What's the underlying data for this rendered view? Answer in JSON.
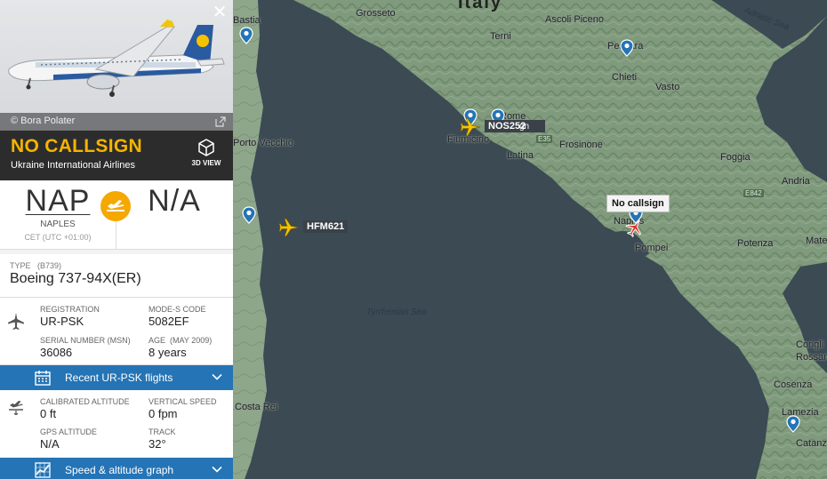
{
  "map": {
    "country_label": "Italy",
    "sea_labels": [
      "Tyrrhenian Sea",
      "Adriatic Sea"
    ],
    "cities": [
      "Grosseto",
      "Terni",
      "Ascoli Piceno",
      "Pescara",
      "Chieti",
      "Vasto",
      "Rome",
      "Fiumicino",
      "Frosinone",
      "Latina",
      "Foggia",
      "Andria",
      "Naples",
      "Pompei",
      "Potenza",
      "Matera",
      "Cosenza",
      "Lamezia",
      "Catanz",
      "Costa Rei",
      "Corigli",
      "Rossan",
      "Bastia",
      "Porto Vecchio"
    ],
    "road_labels": [
      "E35",
      "E842"
    ],
    "flights": [
      {
        "callsign": "HFM621"
      },
      {
        "callsign": "NOS252"
      }
    ],
    "selected_callout": "No callsign",
    "overlap_text": "gn"
  },
  "panel": {
    "photo_credit": "© Bora Polater",
    "callsign": "NO CALLSIGN",
    "airline": "Ukraine International Airlines",
    "view3d_label": "3D VIEW",
    "origin": {
      "code": "NAP",
      "city": "NAPLES",
      "tz": "CET (UTC +01:00)"
    },
    "destination": {
      "code": "N/A"
    },
    "type_label": "TYPE",
    "type_code": "(B739)",
    "type_value": "Boeing 737-94X(ER)",
    "registration": {
      "label": "REGISTRATION",
      "value": "UR-PSK"
    },
    "mode_s": {
      "label": "MODE-S CODE",
      "value": "5082EF"
    },
    "serial": {
      "label": "SERIAL NUMBER (MSN)",
      "value": "36086"
    },
    "age": {
      "label": "AGE",
      "sub": "(MAY 2009)",
      "value": "8 years"
    },
    "recent_flights_label": "Recent UR-PSK flights",
    "calibrated_altitude": {
      "label": "CALIBRATED ALTITUDE",
      "value": "0 ft"
    },
    "vertical_speed": {
      "label": "VERTICAL SPEED",
      "value": "0 fpm"
    },
    "gps_altitude": {
      "label": "GPS ALTITUDE",
      "value": "N/A"
    },
    "track": {
      "label": "TRACK",
      "value": "32°"
    },
    "graph_label": "Speed & altitude graph"
  },
  "colors": {
    "accent": "#f5b400",
    "bar": "#2474b6",
    "header": "#2c2c2c",
    "sea": "#3c4a54"
  }
}
